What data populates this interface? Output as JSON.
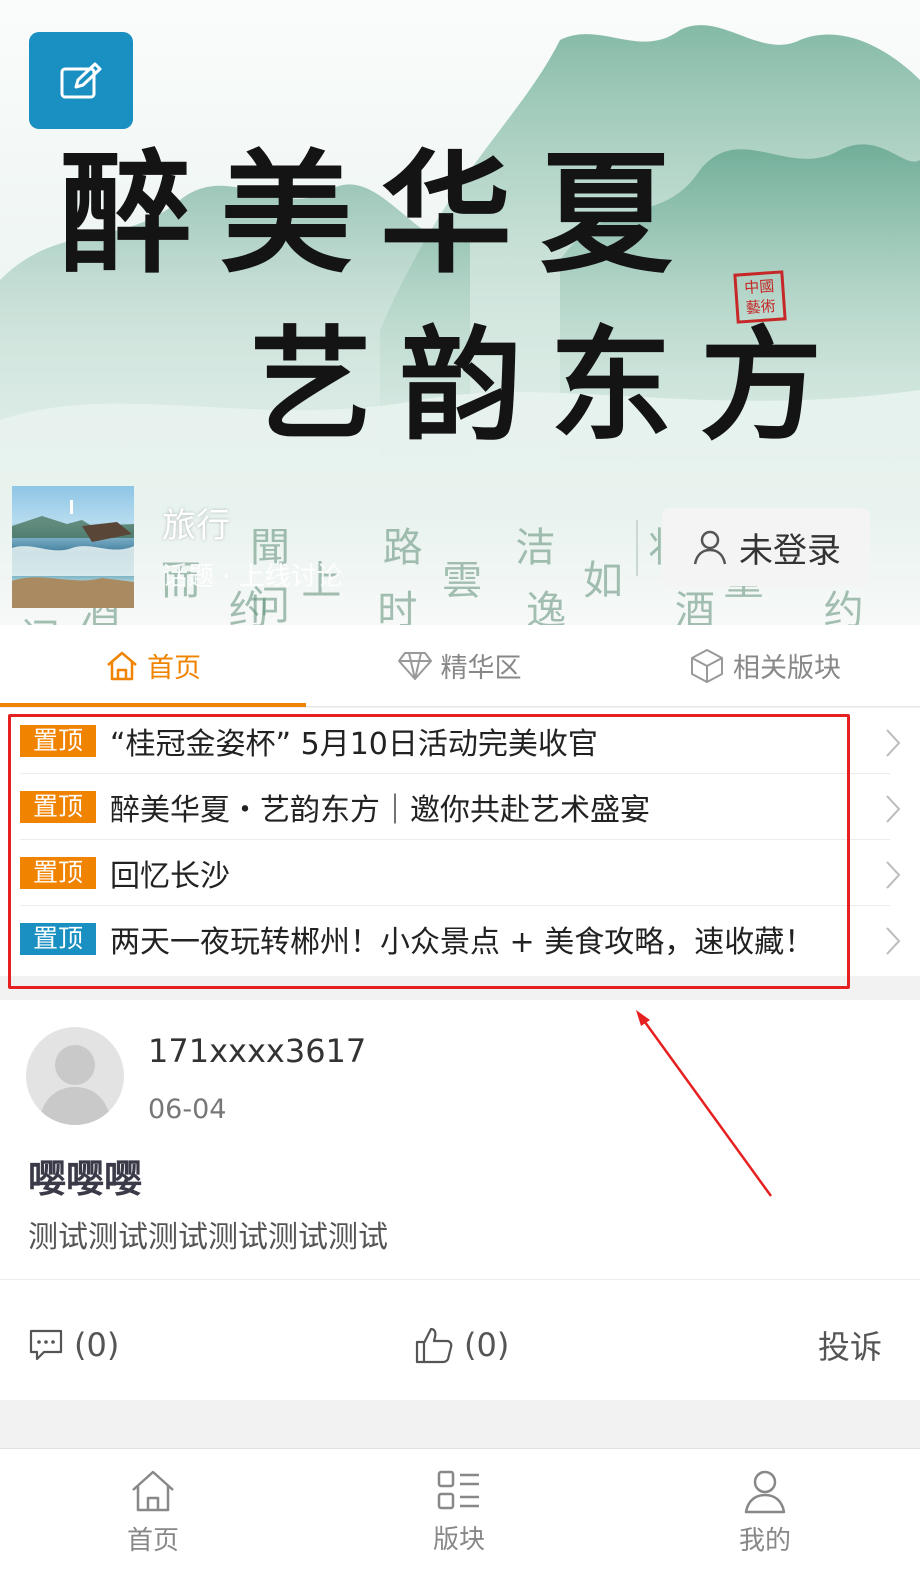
{
  "banner": {
    "title_line1": "醉美华夏",
    "title_line2": "艺韵东方",
    "seal_text": "中國藝術",
    "calligraphy_row1": "聞 路 洁 妆 借 问",
    "calligraphy_row2": "问 而 上 雲 如 童 问",
    "calligraphy_row3": "酒 约 时 逸 酒 约 时",
    "board_name": "旅行",
    "board_sub": "话题 · 上线讨论",
    "login_label": "未登录"
  },
  "tabs": [
    {
      "label": "首页"
    },
    {
      "label": "精华区"
    },
    {
      "label": "相关版块"
    }
  ],
  "pinned": [
    {
      "tag": "置顶",
      "tag_color": "#f08300",
      "title": "“桂冠金姿杯” 5月10日活动完美收官"
    },
    {
      "tag": "置顶",
      "tag_color": "#f08300",
      "title": "醉美华夏・艺韵东方｜邀你共赴艺术盛宴"
    },
    {
      "tag": "置顶",
      "tag_color": "#f08300",
      "title": "回忆长沙"
    },
    {
      "tag": "置顶",
      "tag_color": "#1a8fc1",
      "title": "两天一夜玩转郴州！小众景点 + 美食攻略，速收藏！"
    }
  ],
  "post": {
    "user": "171xxxx3617",
    "date": "06-04",
    "title": "嘤嘤嘤",
    "body": "测试测试测试测试测试测试",
    "comments": "(0)",
    "likes": "(0)",
    "report": "投诉"
  },
  "bottom_nav": [
    {
      "label": "首页",
      "icon": "home-icon"
    },
    {
      "label": "版块",
      "icon": "grid-list-icon"
    },
    {
      "label": "我的",
      "icon": "user-icon"
    }
  ],
  "colors": {
    "accent": "#f08300",
    "brand_blue": "#1a8fc1",
    "annotation_red": "#e62020"
  }
}
